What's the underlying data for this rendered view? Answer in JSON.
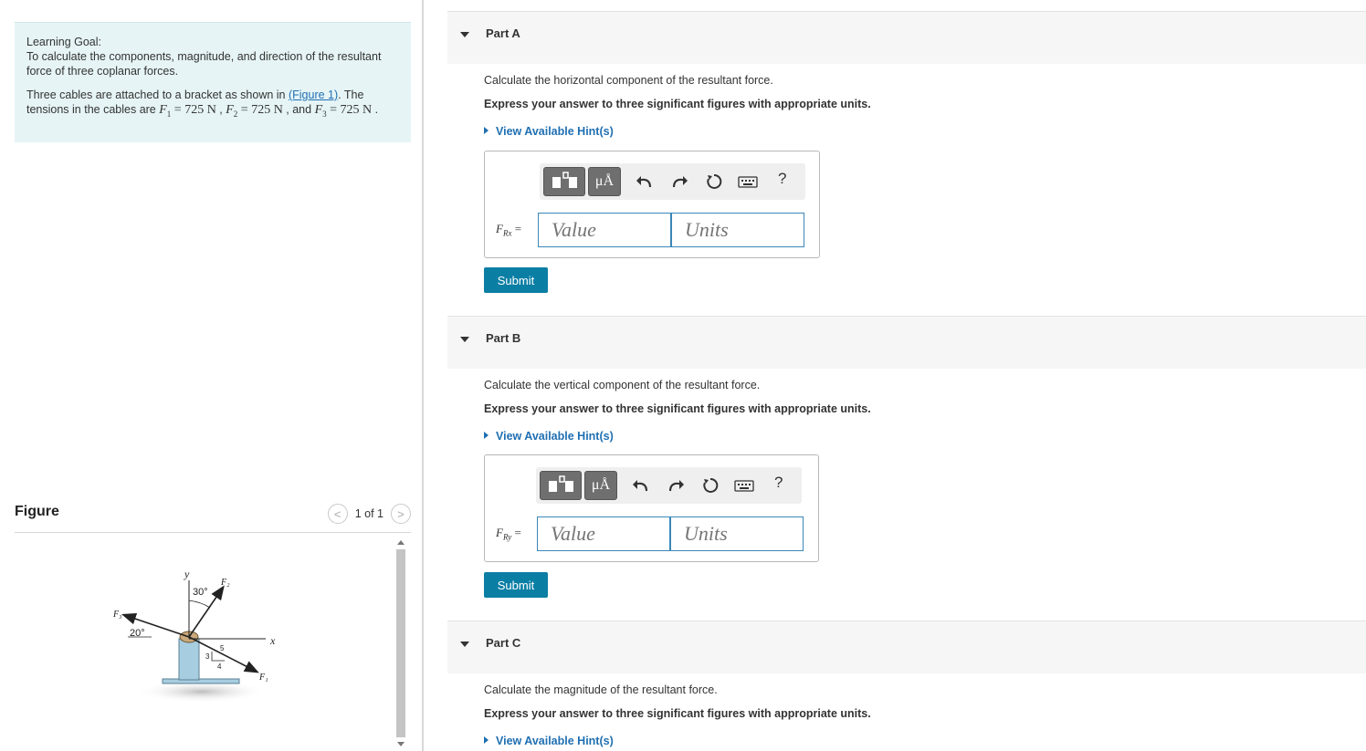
{
  "learning_goal": {
    "title": "Learning Goal:",
    "text": "To calculate the components, magnitude, and direction of the resultant force of three coplanar forces.",
    "problem_pre": "Three cables are attached to a bracket as shown in ",
    "figure_link": "(Figure 1)",
    "problem_mid": ". The tensions in the cables are ",
    "f1_sym": "F",
    "f1_sub": "1",
    "f1_val": " = 725 N",
    "f2_sym": "F",
    "f2_sub": "2",
    "f2_val": " = 725 N",
    "f3_sym": "F",
    "f3_sub": "3",
    "f3_val": " = 725 N",
    "sep1": " , ",
    "sep2": " , and ",
    "end": " ."
  },
  "figure": {
    "label": "Figure",
    "pager": "1 of 1",
    "prev": "<",
    "next": ">",
    "labels": {
      "y": "y",
      "x": "x",
      "f1": "F₁",
      "f2": "F₂",
      "f3": "F₃",
      "angle30": "30°",
      "angle20": "20°",
      "tri3": "3",
      "tri4": "4",
      "tri5": "5"
    }
  },
  "parts": [
    {
      "title": "Part A",
      "question": "Calculate the horizontal component of the resultant force.",
      "instruction": "Express your answer to three significant figures with appropriate units.",
      "hint": "View Available Hint(s)",
      "label_sym": "F",
      "label_sub": "Rx",
      "label_eq": " =",
      "value_placeholder": "Value",
      "units_placeholder": "Units",
      "submit": "Submit"
    },
    {
      "title": "Part B",
      "question": "Calculate the vertical component of the resultant force.",
      "instruction": "Express your answer to three significant figures with appropriate units.",
      "hint": "View Available Hint(s)",
      "label_sym": "F",
      "label_sub": "Ry",
      "label_eq": " =",
      "value_placeholder": "Value",
      "units_placeholder": "Units",
      "submit": "Submit"
    },
    {
      "title": "Part C",
      "question": "Calculate the magnitude of the resultant force.",
      "instruction": "Express your answer to three significant figures with appropriate units.",
      "hint": "View Available Hint(s)"
    }
  ],
  "toolbar": {
    "units_symbol": "μÅ",
    "help": "?",
    "icons": [
      "templates-icon",
      "units-icon",
      "undo-icon",
      "redo-icon",
      "reset-icon",
      "keyboard-icon",
      "help-icon"
    ]
  },
  "colors": {
    "goal_bg": "#e6f4f6",
    "link": "#1f6fb2",
    "submit_bg": "#0b7ea4",
    "input_border": "#3b87b8"
  }
}
